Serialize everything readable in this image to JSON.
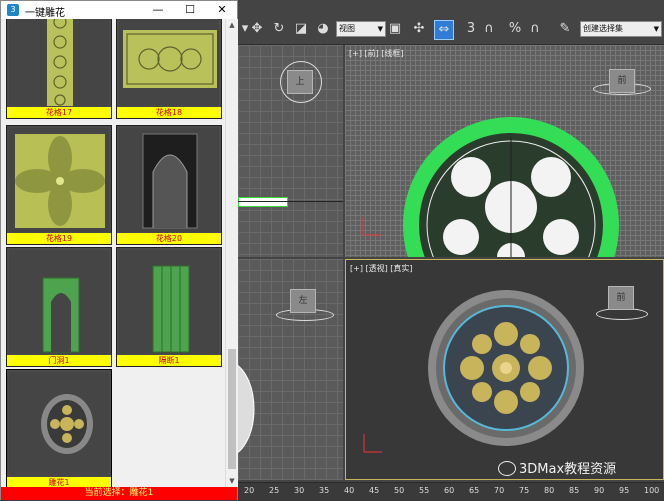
{
  "window": {
    "title": "一键雕花",
    "min_icon": "—",
    "max_icon": "☐",
    "close_icon": "✕"
  },
  "library": {
    "items": [
      {
        "label": "花格17"
      },
      {
        "label": "花格18"
      },
      {
        "label": "花格19"
      },
      {
        "label": "花格20"
      },
      {
        "label": "门洞1"
      },
      {
        "label": "隔断1"
      },
      {
        "label": "雕花1"
      }
    ]
  },
  "status_text": "当前选择：雕花1",
  "toolbar": {
    "view_select": "视图",
    "selection_set": "创建选择集",
    "percent_label": "%",
    "snap_label": "3"
  },
  "viewports": {
    "top_right_label": "[+] [前] [线框]",
    "bottom_right_label": "[+] [透视] [真实]",
    "cube_top": "上",
    "cube_left": "左",
    "cube_front": "前",
    "cube_persp": "前"
  },
  "timeline": {
    "ticks": [
      "20",
      "25",
      "30",
      "35",
      "40",
      "45",
      "50",
      "55",
      "60",
      "65",
      "70",
      "75",
      "80",
      "85",
      "90",
      "95",
      "100"
    ]
  },
  "watermark": "3DMax教程资源",
  "colors": {
    "caption_bg": "#ffff00",
    "caption_text": "#d00000",
    "status_bg": "#ff0000",
    "selection_green": "#33dd55",
    "carving_gold": "#c8b45a"
  }
}
